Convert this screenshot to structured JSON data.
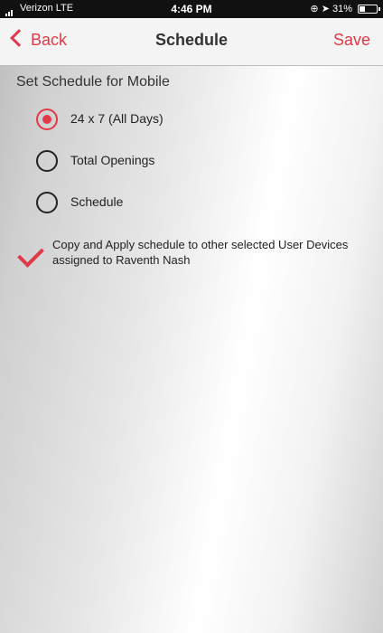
{
  "status_bar": {
    "carrier": "Verizon  LTE",
    "time": "4:46 PM",
    "battery_text": "31%"
  },
  "nav": {
    "back_label": "Back",
    "title": "Schedule",
    "save_label": "Save"
  },
  "section_title": "Set Schedule for Mobile",
  "options": [
    {
      "label": "24 x 7 (All Days)",
      "selected": true
    },
    {
      "label": "Total Openings",
      "selected": false
    },
    {
      "label": "Schedule",
      "selected": false
    }
  ],
  "copy_apply": {
    "checked": true,
    "label": "Copy and Apply schedule to other selected User Devices assigned to Raventh  Nash"
  },
  "colors": {
    "accent": "#e03a48"
  }
}
